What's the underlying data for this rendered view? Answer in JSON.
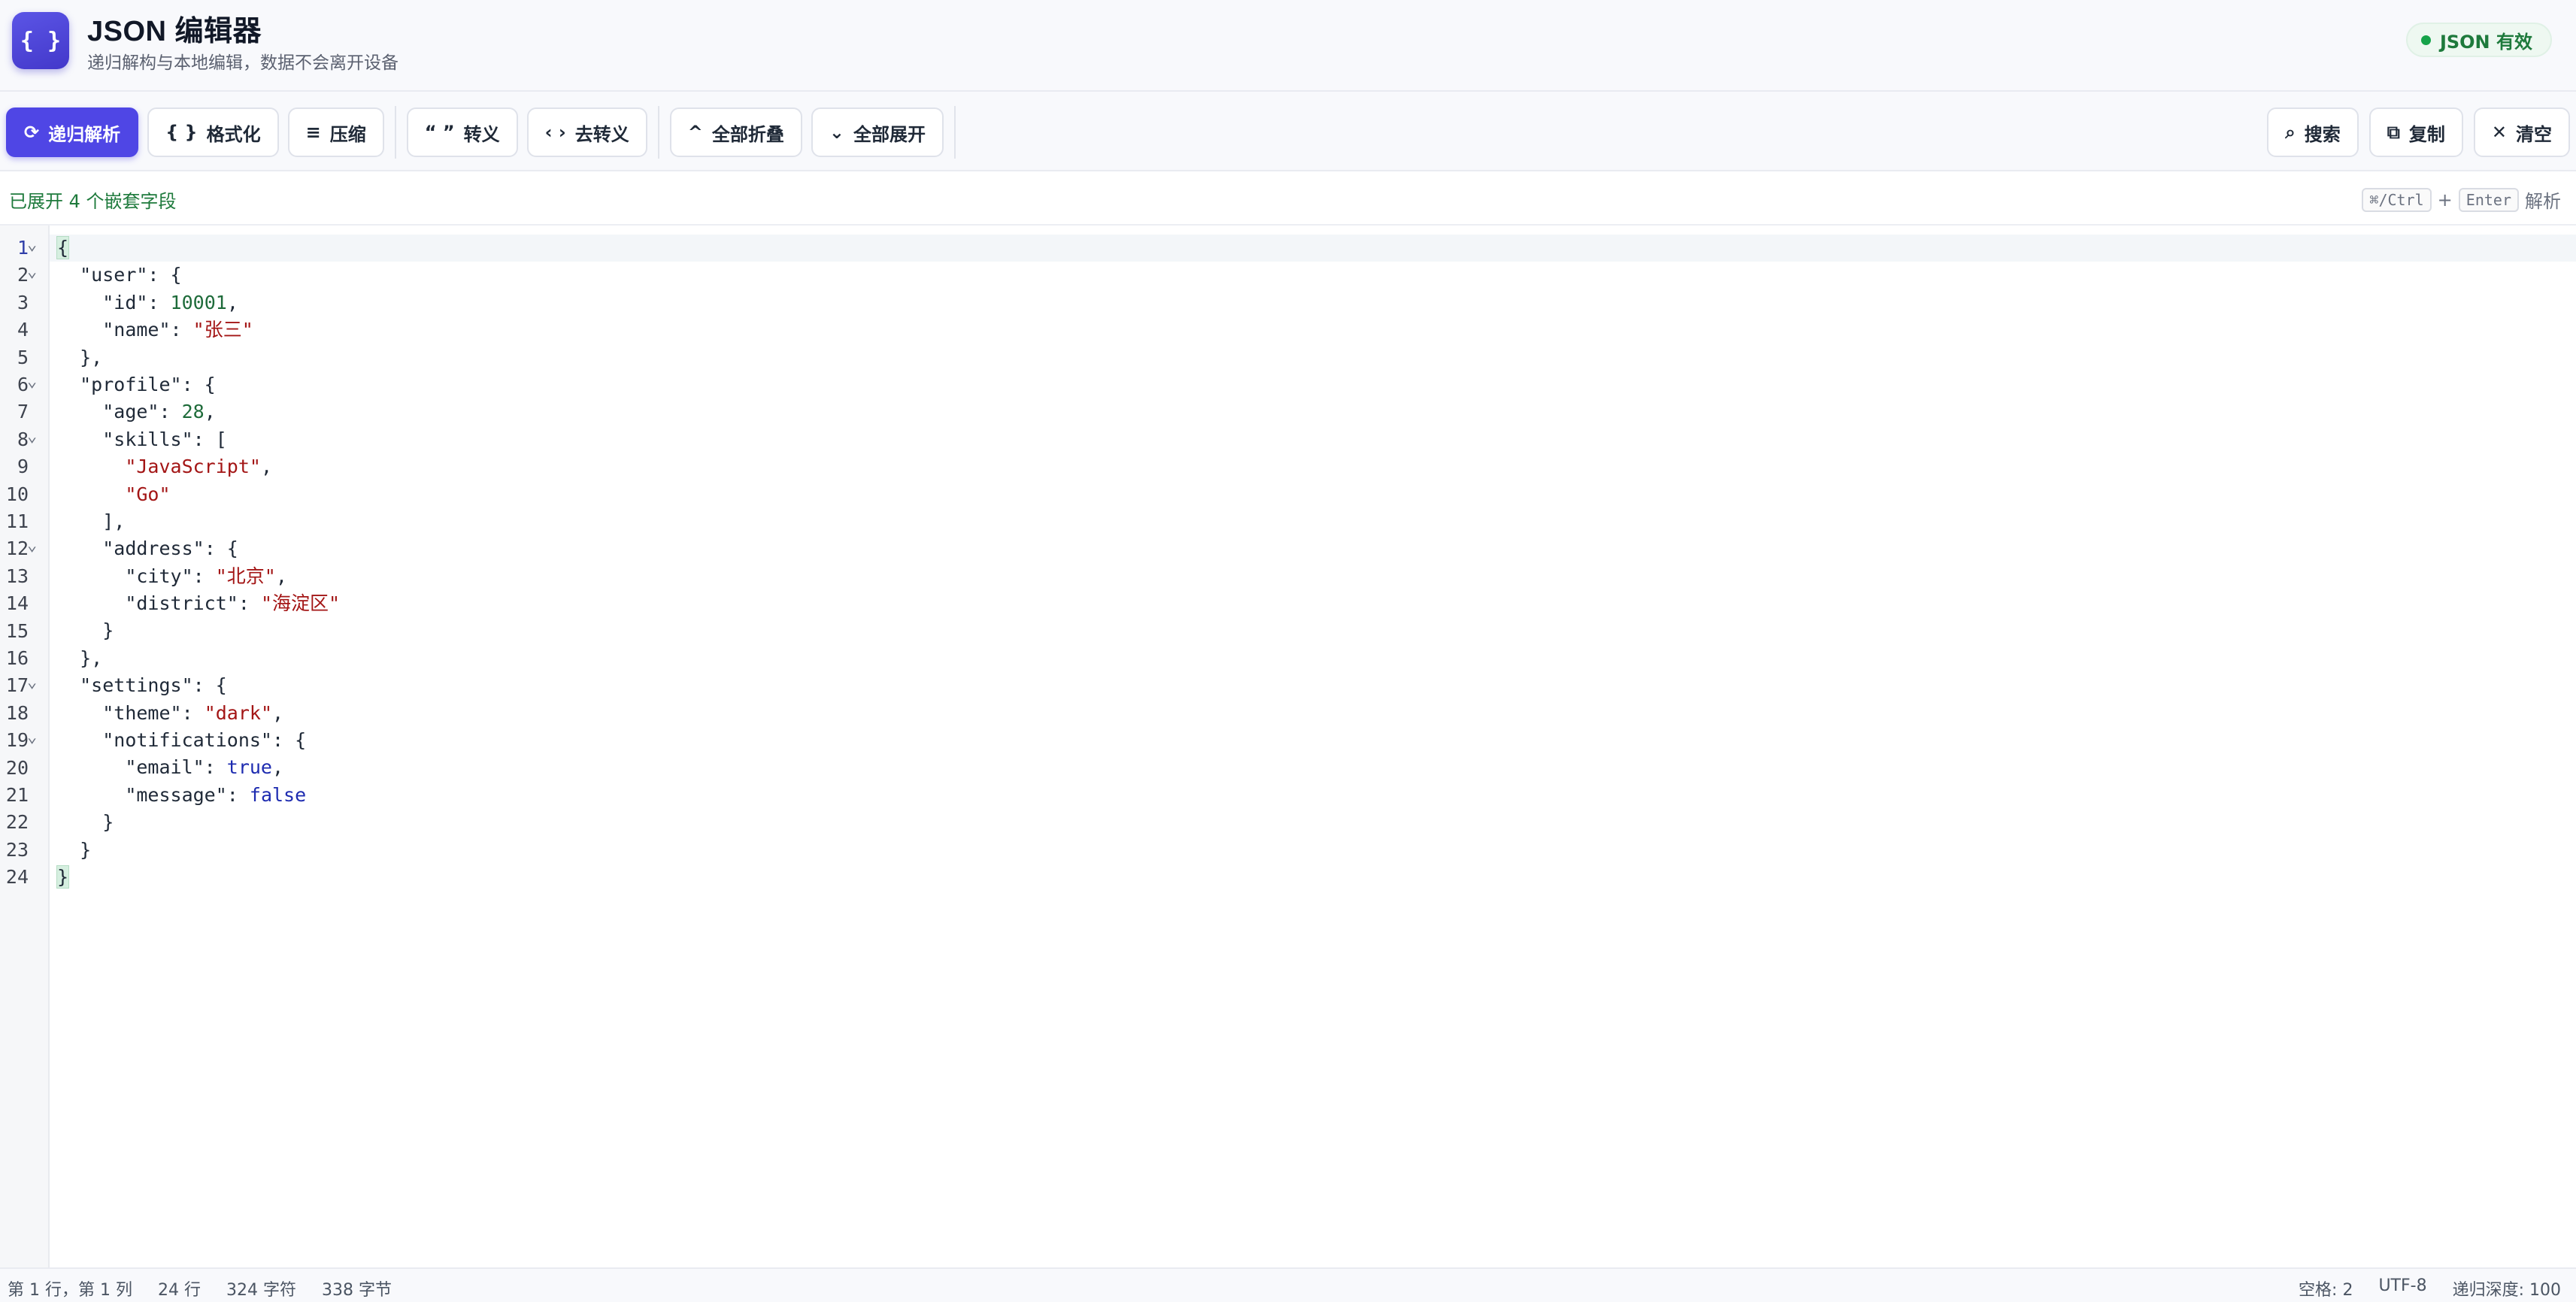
{
  "app": {
    "logo_text": "{ }",
    "title": "JSON 编辑器",
    "subtitle": "递归解构与本地编辑，数据不会离开设备",
    "status": "JSON 有效",
    "status_color": "#16a34a",
    "accent": "#4f46e5"
  },
  "toolbar": {
    "parse": {
      "icon": "refresh-icon",
      "glyph": "⟳",
      "label": "递归解析"
    },
    "format": {
      "icon": "braces-icon",
      "glyph": "{ }",
      "label": "格式化"
    },
    "compress": {
      "icon": "lines-icon",
      "glyph": "≡",
      "label": "压缩"
    },
    "escape": {
      "icon": "quotes-icon",
      "glyph": "“ ”",
      "label": "转义"
    },
    "unescape": {
      "icon": "angle-brackets-icon",
      "glyph": "‹ ›",
      "label": "去转义"
    },
    "collapse_all": {
      "icon": "chevron-up-icon",
      "glyph": "^",
      "label": "全部折叠"
    },
    "expand_all": {
      "icon": "chevron-down-icon",
      "glyph": "⌄",
      "label": "全部展开"
    },
    "search": {
      "icon": "search-icon",
      "glyph": "⌕",
      "label": "搜索"
    },
    "copy": {
      "icon": "copy-icon",
      "glyph": "⧉",
      "label": "复制"
    },
    "clear": {
      "icon": "close-icon",
      "glyph": "✕",
      "label": "清空"
    }
  },
  "infobar": {
    "message": "已展开 4 个嵌套字段",
    "shortcut_key1": "⌘/Ctrl",
    "shortcut_plus": "+",
    "shortcut_key2": "Enter",
    "shortcut_action": "解析"
  },
  "editor": {
    "active_line": 1,
    "lines": [
      {
        "n": "1",
        "fold": true,
        "tokens": [
          [
            "bm",
            "{"
          ]
        ]
      },
      {
        "n": "2",
        "fold": true,
        "tokens": [
          [
            "ws",
            "  "
          ],
          [
            "key",
            "\"user\""
          ],
          [
            "p",
            ": {"
          ]
        ]
      },
      {
        "n": "3",
        "fold": false,
        "tokens": [
          [
            "ws",
            "    "
          ],
          [
            "key",
            "\"id\""
          ],
          [
            "p",
            ": "
          ],
          [
            "num",
            "10001"
          ],
          [
            "p",
            ","
          ]
        ]
      },
      {
        "n": "4",
        "fold": false,
        "tokens": [
          [
            "ws",
            "    "
          ],
          [
            "key",
            "\"name\""
          ],
          [
            "p",
            ": "
          ],
          [
            "str",
            "\"张三\""
          ]
        ]
      },
      {
        "n": "5",
        "fold": false,
        "tokens": [
          [
            "ws",
            "  "
          ],
          [
            "p",
            "},"
          ]
        ]
      },
      {
        "n": "6",
        "fold": true,
        "tokens": [
          [
            "ws",
            "  "
          ],
          [
            "key",
            "\"profile\""
          ],
          [
            "p",
            ": {"
          ]
        ]
      },
      {
        "n": "7",
        "fold": false,
        "tokens": [
          [
            "ws",
            "    "
          ],
          [
            "key",
            "\"age\""
          ],
          [
            "p",
            ": "
          ],
          [
            "num",
            "28"
          ],
          [
            "p",
            ","
          ]
        ]
      },
      {
        "n": "8",
        "fold": true,
        "tokens": [
          [
            "ws",
            "    "
          ],
          [
            "key",
            "\"skills\""
          ],
          [
            "p",
            ": ["
          ]
        ]
      },
      {
        "n": "9",
        "fold": false,
        "tokens": [
          [
            "ws",
            "      "
          ],
          [
            "str",
            "\"JavaScript\""
          ],
          [
            "p",
            ","
          ]
        ]
      },
      {
        "n": "10",
        "fold": false,
        "tokens": [
          [
            "ws",
            "      "
          ],
          [
            "str",
            "\"Go\""
          ]
        ]
      },
      {
        "n": "11",
        "fold": false,
        "tokens": [
          [
            "ws",
            "    "
          ],
          [
            "p",
            "],"
          ]
        ]
      },
      {
        "n": "12",
        "fold": true,
        "tokens": [
          [
            "ws",
            "    "
          ],
          [
            "key",
            "\"address\""
          ],
          [
            "p",
            ": {"
          ]
        ]
      },
      {
        "n": "13",
        "fold": false,
        "tokens": [
          [
            "ws",
            "      "
          ],
          [
            "key",
            "\"city\""
          ],
          [
            "p",
            ": "
          ],
          [
            "str",
            "\"北京\""
          ],
          [
            "p",
            ","
          ]
        ]
      },
      {
        "n": "14",
        "fold": false,
        "tokens": [
          [
            "ws",
            "      "
          ],
          [
            "key",
            "\"district\""
          ],
          [
            "p",
            ": "
          ],
          [
            "str",
            "\"海淀区\""
          ]
        ]
      },
      {
        "n": "15",
        "fold": false,
        "tokens": [
          [
            "ws",
            "    "
          ],
          [
            "p",
            "}"
          ]
        ]
      },
      {
        "n": "16",
        "fold": false,
        "tokens": [
          [
            "ws",
            "  "
          ],
          [
            "p",
            "},"
          ]
        ]
      },
      {
        "n": "17",
        "fold": true,
        "tokens": [
          [
            "ws",
            "  "
          ],
          [
            "key",
            "\"settings\""
          ],
          [
            "p",
            ": {"
          ]
        ]
      },
      {
        "n": "18",
        "fold": false,
        "tokens": [
          [
            "ws",
            "    "
          ],
          [
            "key",
            "\"theme\""
          ],
          [
            "p",
            ": "
          ],
          [
            "str",
            "\"dark\""
          ],
          [
            "p",
            ","
          ]
        ]
      },
      {
        "n": "19",
        "fold": true,
        "tokens": [
          [
            "ws",
            "    "
          ],
          [
            "key",
            "\"notifications\""
          ],
          [
            "p",
            ": {"
          ]
        ]
      },
      {
        "n": "20",
        "fold": false,
        "tokens": [
          [
            "ws",
            "      "
          ],
          [
            "key",
            "\"email\""
          ],
          [
            "p",
            ": "
          ],
          [
            "bool",
            "true"
          ],
          [
            "p",
            ","
          ]
        ]
      },
      {
        "n": "21",
        "fold": false,
        "tokens": [
          [
            "ws",
            "      "
          ],
          [
            "key",
            "\"message\""
          ],
          [
            "p",
            ": "
          ],
          [
            "bool",
            "false"
          ]
        ]
      },
      {
        "n": "22",
        "fold": false,
        "tokens": [
          [
            "ws",
            "    "
          ],
          [
            "p",
            "}"
          ]
        ]
      },
      {
        "n": "23",
        "fold": false,
        "tokens": [
          [
            "ws",
            "  "
          ],
          [
            "p",
            "}"
          ]
        ]
      },
      {
        "n": "24",
        "fold": false,
        "tokens": [
          [
            "bm",
            "}"
          ]
        ]
      }
    ]
  },
  "statusbar": {
    "cursor": "第 1 行，第 1 列",
    "line_count": "24 行",
    "char_count": "324 字符",
    "byte_count": "338 字节",
    "indent": "空格: 2",
    "encoding": "UTF-8",
    "depth": "递归深度: 100"
  }
}
